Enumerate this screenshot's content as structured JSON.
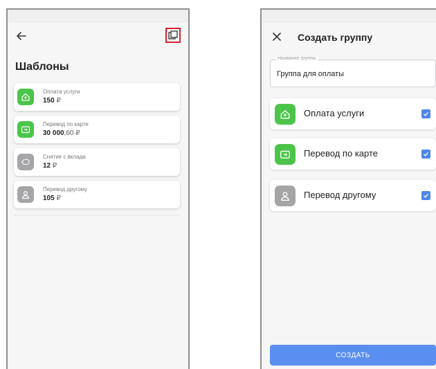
{
  "left_screen": {
    "title": "Шаблоны",
    "templates": [
      {
        "label": "Оплата услуги",
        "amount_main": "150",
        "amount_decimal": "",
        "currency": "₽",
        "icon": "house-icon",
        "icon_color": "#4cc44a"
      },
      {
        "label": "Перевод по карте",
        "amount_main": "30 000",
        "amount_decimal": ",60",
        "currency": "₽",
        "icon": "card-transfer-icon",
        "icon_color": "#4cc44a"
      },
      {
        "label": "Снятие с вклада",
        "amount_main": "12",
        "amount_decimal": "",
        "currency": "₽",
        "icon": "piggy-bank-icon",
        "icon_color": "#a5a5a8"
      },
      {
        "label": "Перевод другому",
        "amount_main": "105",
        "amount_decimal": "",
        "currency": "₽",
        "icon": "person-icon",
        "icon_color": "#a5a5a8"
      }
    ],
    "highlight_color": "#d6212b"
  },
  "right_screen": {
    "title": "Создать группу",
    "group_name_label": "Название группы",
    "group_name_value": "Группа для оплаты",
    "items": [
      {
        "label": "Оплата услуги",
        "icon": "house-icon",
        "icon_color": "#4cc44a",
        "checked": true
      },
      {
        "label": "Перевод по карте",
        "icon": "card-transfer-icon",
        "icon_color": "#4cc44a",
        "checked": true
      },
      {
        "label": "Перевод другому",
        "icon": "person-icon",
        "icon_color": "#a5a5a8",
        "checked": true
      }
    ],
    "create_button": "СОЗДАТЬ",
    "accent_color": "#5a8ef0"
  }
}
